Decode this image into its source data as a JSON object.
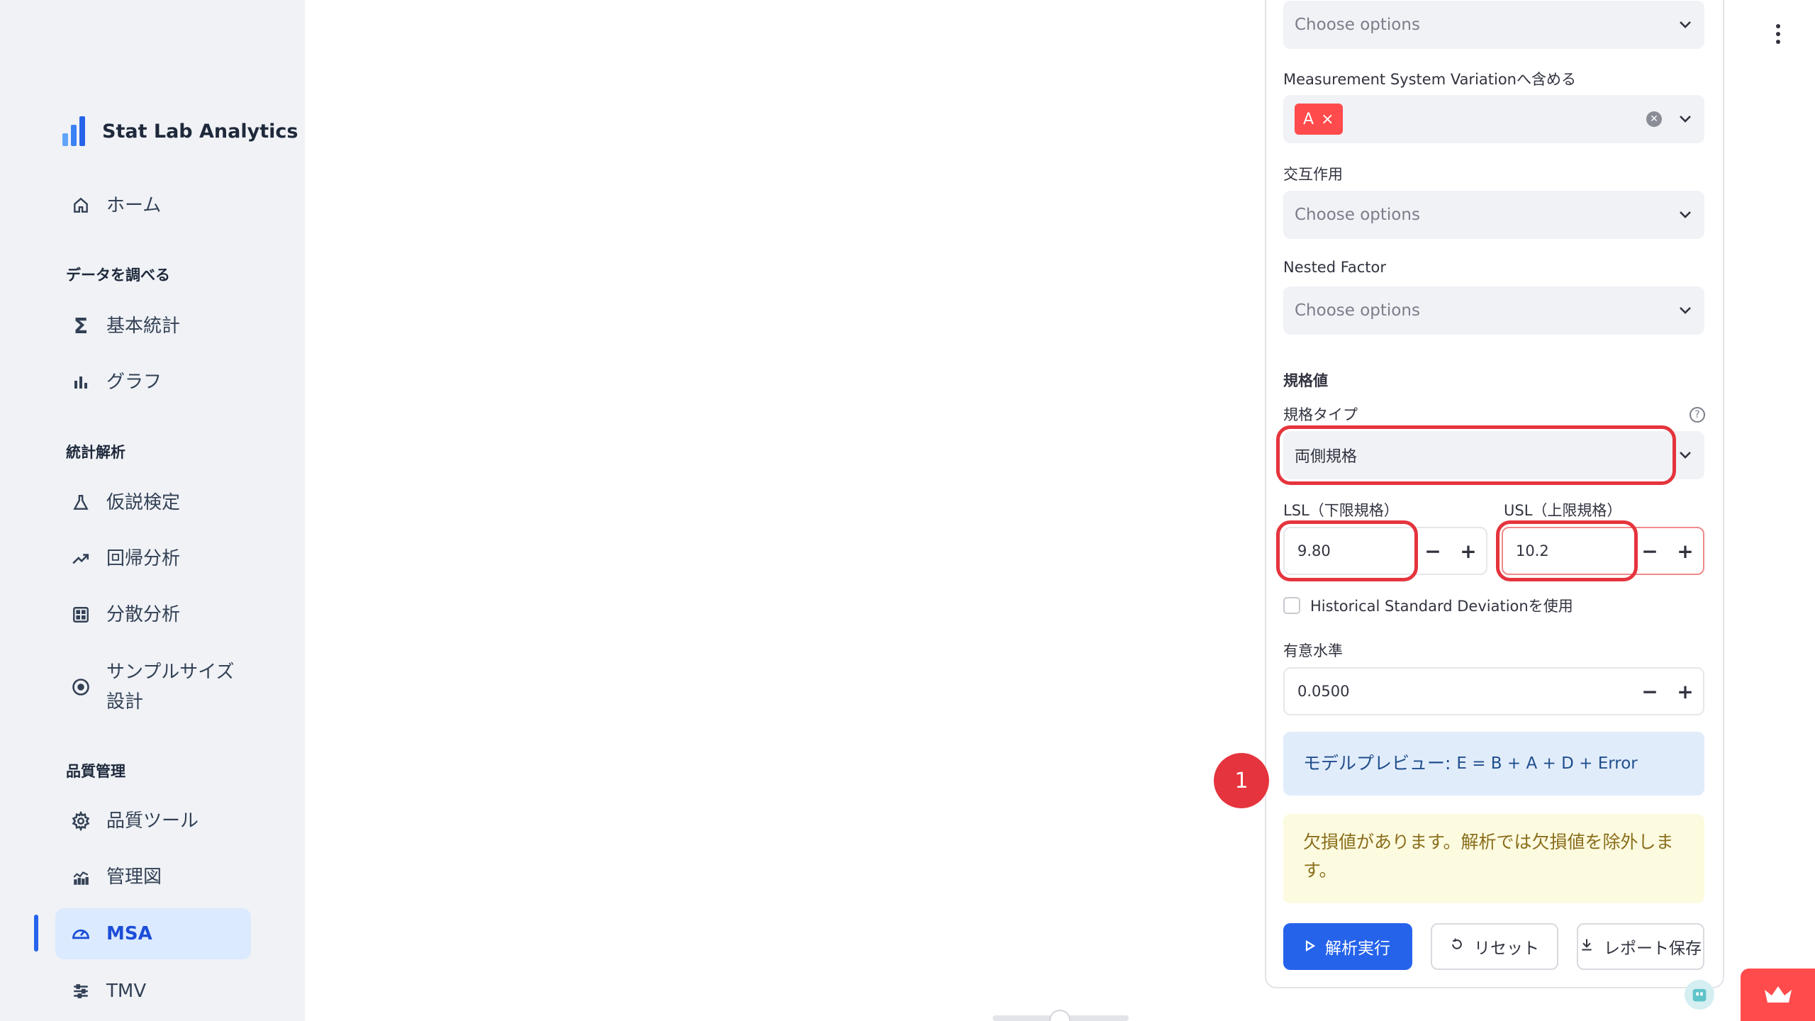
{
  "app": {
    "name": "Stat Lab Analytics"
  },
  "sidebar": {
    "home": {
      "label": "ホーム",
      "icon": "home-icon"
    },
    "sections": [
      {
        "title": "データを調べる"
      },
      {
        "title": "統計解析"
      },
      {
        "title": "品質管理"
      }
    ],
    "items": [
      {
        "label": "基本統計",
        "icon": "sigma-icon"
      },
      {
        "label": "グラフ",
        "icon": "bar-chart-icon"
      },
      {
        "label": "仮説検定",
        "icon": "flask-icon"
      },
      {
        "label": "回帰分析",
        "icon": "trend-up-icon"
      },
      {
        "label": "分散分析",
        "icon": "grid-icon"
      },
      {
        "label": "サンプルサイズ\n設計",
        "icon": "target-icon"
      },
      {
        "label": "品質ツール",
        "icon": "gear-icon"
      },
      {
        "label": "管理図",
        "icon": "control-chart-icon"
      },
      {
        "label": "MSA",
        "icon": "gauge-icon",
        "active": true
      },
      {
        "label": "TMV",
        "icon": "sliders-icon"
      }
    ]
  },
  "form": {
    "top_select": {
      "placeholder": "Choose options"
    },
    "msv": {
      "label": "Measurement System Variationへ含める",
      "chip": "A",
      "chip_close": "×"
    },
    "interaction": {
      "label": "交互作用",
      "placeholder": "Choose options"
    },
    "nested": {
      "label": "Nested Factor",
      "placeholder": "Choose options"
    },
    "spec_section": "規格値",
    "spec_type": {
      "label": "規格タイプ",
      "value": "両側規格",
      "help": "?"
    },
    "lsl": {
      "label": "LSL（下限規格）",
      "value": "9.80"
    },
    "usl": {
      "label": "USL（上限規格）",
      "value": "10.2"
    },
    "historical_sd": {
      "label": "Historical Standard Deviationを使用"
    },
    "alpha": {
      "label": "有意水準",
      "value": "0.0500"
    },
    "stepper": {
      "minus": "−",
      "plus": "+"
    },
    "model_preview": {
      "prefix": "モデルプレビュー: ",
      "formula": "E = B + A + D + Error"
    },
    "missing_warning": "欠損値があります。解析では欠損値を除外します。",
    "buttons": {
      "run": "解析実行",
      "reset": "リセット",
      "save": "レポート保存"
    }
  },
  "annotation": {
    "badge": "1"
  },
  "colors": {
    "accent": "#2563eb",
    "highlight": "#e5343d",
    "chip": "#ff4b4b"
  }
}
